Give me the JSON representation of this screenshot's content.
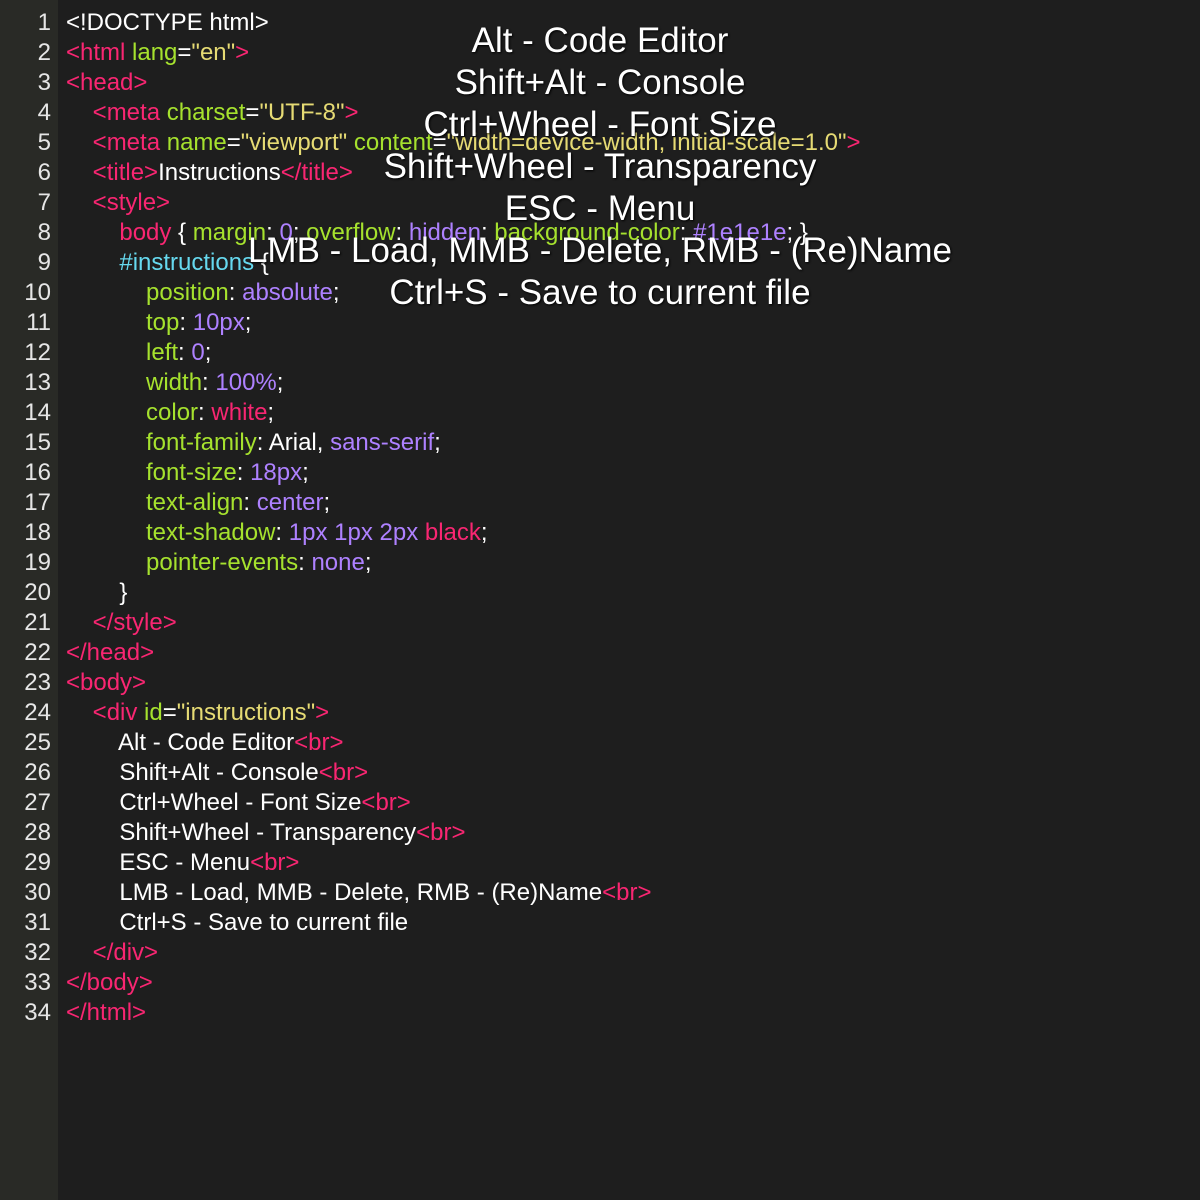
{
  "colors": {
    "background": "#1e1e1e",
    "gutter": "#292a26",
    "tag": "#f92672",
    "attribute": "#a6e22e",
    "string": "#e6db74",
    "number_keyword": "#ae81ff",
    "selector_id": "#66d9ef",
    "plain": "#ffffff"
  },
  "editor": {
    "lines": [
      {
        "n": "1",
        "tokens": [
          {
            "c": "pl",
            "t": "<!DOCTYPE html>"
          }
        ]
      },
      {
        "n": "2",
        "tokens": [
          {
            "c": "tag",
            "t": "<html "
          },
          {
            "c": "attr",
            "t": "lang"
          },
          {
            "c": "pl",
            "t": "="
          },
          {
            "c": "str",
            "t": "\"en\""
          },
          {
            "c": "tag",
            "t": ">"
          }
        ]
      },
      {
        "n": "3",
        "tokens": [
          {
            "c": "tag",
            "t": "<head>"
          }
        ]
      },
      {
        "n": "4",
        "tokens": [
          {
            "c": "pl",
            "t": "    "
          },
          {
            "c": "tag",
            "t": "<meta "
          },
          {
            "c": "attr",
            "t": "charset"
          },
          {
            "c": "pl",
            "t": "="
          },
          {
            "c": "str",
            "t": "\"UTF-8\""
          },
          {
            "c": "tag",
            "t": ">"
          }
        ]
      },
      {
        "n": "5",
        "tokens": [
          {
            "c": "pl",
            "t": "    "
          },
          {
            "c": "tag",
            "t": "<meta "
          },
          {
            "c": "attr",
            "t": "name"
          },
          {
            "c": "pl",
            "t": "="
          },
          {
            "c": "str",
            "t": "\"viewport\""
          },
          {
            "c": "pl",
            "t": " "
          },
          {
            "c": "attr",
            "t": "content"
          },
          {
            "c": "pl",
            "t": "="
          },
          {
            "c": "str",
            "t": "\"width=device-width, initial-scale=1.0\""
          },
          {
            "c": "tag",
            "t": ">"
          }
        ]
      },
      {
        "n": "6",
        "tokens": [
          {
            "c": "pl",
            "t": "    "
          },
          {
            "c": "tag",
            "t": "<title>"
          },
          {
            "c": "pl",
            "t": "Instructions"
          },
          {
            "c": "tag",
            "t": "</title>"
          }
        ]
      },
      {
        "n": "7",
        "tokens": [
          {
            "c": "pl",
            "t": "    "
          },
          {
            "c": "tag",
            "t": "<style>"
          }
        ]
      },
      {
        "n": "8",
        "tokens": [
          {
            "c": "pl",
            "t": "        "
          },
          {
            "c": "tag",
            "t": "body"
          },
          {
            "c": "pl",
            "t": " { "
          },
          {
            "c": "attr",
            "t": "margin"
          },
          {
            "c": "pl",
            "t": ": "
          },
          {
            "c": "num",
            "t": "0"
          },
          {
            "c": "pl",
            "t": "; "
          },
          {
            "c": "attr",
            "t": "overflow"
          },
          {
            "c": "pl",
            "t": ": "
          },
          {
            "c": "num",
            "t": "hidden"
          },
          {
            "c": "pl",
            "t": "; "
          },
          {
            "c": "attr",
            "t": "background-color"
          },
          {
            "c": "pl",
            "t": ": "
          },
          {
            "c": "num",
            "t": "#1e1e1e"
          },
          {
            "c": "pl",
            "t": "; }"
          }
        ]
      },
      {
        "n": "9",
        "tokens": [
          {
            "c": "pl",
            "t": "        "
          },
          {
            "c": "id",
            "t": "#instructions"
          },
          {
            "c": "pl",
            "t": " {"
          }
        ]
      },
      {
        "n": "10",
        "tokens": [
          {
            "c": "pl",
            "t": "            "
          },
          {
            "c": "attr",
            "t": "position"
          },
          {
            "c": "pl",
            "t": ": "
          },
          {
            "c": "num",
            "t": "absolute"
          },
          {
            "c": "pl",
            "t": ";"
          }
        ]
      },
      {
        "n": "11",
        "tokens": [
          {
            "c": "pl",
            "t": "            "
          },
          {
            "c": "attr",
            "t": "top"
          },
          {
            "c": "pl",
            "t": ": "
          },
          {
            "c": "num",
            "t": "10px"
          },
          {
            "c": "pl",
            "t": ";"
          }
        ]
      },
      {
        "n": "12",
        "tokens": [
          {
            "c": "pl",
            "t": "            "
          },
          {
            "c": "attr",
            "t": "left"
          },
          {
            "c": "pl",
            "t": ": "
          },
          {
            "c": "num",
            "t": "0"
          },
          {
            "c": "pl",
            "t": ";"
          }
        ]
      },
      {
        "n": "13",
        "tokens": [
          {
            "c": "pl",
            "t": "            "
          },
          {
            "c": "attr",
            "t": "width"
          },
          {
            "c": "pl",
            "t": ": "
          },
          {
            "c": "num",
            "t": "100%"
          },
          {
            "c": "pl",
            "t": ";"
          }
        ]
      },
      {
        "n": "14",
        "tokens": [
          {
            "c": "pl",
            "t": "            "
          },
          {
            "c": "attr",
            "t": "color"
          },
          {
            "c": "pl",
            "t": ": "
          },
          {
            "c": "tag",
            "t": "white"
          },
          {
            "c": "pl",
            "t": ";"
          }
        ]
      },
      {
        "n": "15",
        "tokens": [
          {
            "c": "pl",
            "t": "            "
          },
          {
            "c": "attr",
            "t": "font-family"
          },
          {
            "c": "pl",
            "t": ": Arial, "
          },
          {
            "c": "num",
            "t": "sans-serif"
          },
          {
            "c": "pl",
            "t": ";"
          }
        ]
      },
      {
        "n": "16",
        "tokens": [
          {
            "c": "pl",
            "t": "            "
          },
          {
            "c": "attr",
            "t": "font-size"
          },
          {
            "c": "pl",
            "t": ": "
          },
          {
            "c": "num",
            "t": "18px"
          },
          {
            "c": "pl",
            "t": ";"
          }
        ]
      },
      {
        "n": "17",
        "tokens": [
          {
            "c": "pl",
            "t": "            "
          },
          {
            "c": "attr",
            "t": "text-align"
          },
          {
            "c": "pl",
            "t": ": "
          },
          {
            "c": "num",
            "t": "center"
          },
          {
            "c": "pl",
            "t": ";"
          }
        ]
      },
      {
        "n": "18",
        "tokens": [
          {
            "c": "pl",
            "t": "            "
          },
          {
            "c": "attr",
            "t": "text-shadow"
          },
          {
            "c": "pl",
            "t": ": "
          },
          {
            "c": "num",
            "t": "1px 1px 2px "
          },
          {
            "c": "tag",
            "t": "black"
          },
          {
            "c": "pl",
            "t": ";"
          }
        ]
      },
      {
        "n": "19",
        "tokens": [
          {
            "c": "pl",
            "t": "            "
          },
          {
            "c": "attr",
            "t": "pointer-events"
          },
          {
            "c": "pl",
            "t": ": "
          },
          {
            "c": "num",
            "t": "none"
          },
          {
            "c": "pl",
            "t": ";"
          }
        ]
      },
      {
        "n": "20",
        "tokens": [
          {
            "c": "pl",
            "t": "        }"
          }
        ]
      },
      {
        "n": "21",
        "tokens": [
          {
            "c": "pl",
            "t": "    "
          },
          {
            "c": "tag",
            "t": "</style>"
          }
        ]
      },
      {
        "n": "22",
        "tokens": [
          {
            "c": "tag",
            "t": "</head>"
          }
        ]
      },
      {
        "n": "23",
        "tokens": [
          {
            "c": "tag",
            "t": "<body>"
          }
        ]
      },
      {
        "n": "24",
        "tokens": [
          {
            "c": "pl",
            "t": "    "
          },
          {
            "c": "tag",
            "t": "<div "
          },
          {
            "c": "attr",
            "t": "id"
          },
          {
            "c": "pl",
            "t": "="
          },
          {
            "c": "str",
            "t": "\"instructions\""
          },
          {
            "c": "tag",
            "t": ">"
          }
        ]
      },
      {
        "n": "25",
        "tokens": [
          {
            "c": "pl",
            "t": "        Alt - Code Editor"
          },
          {
            "c": "tag",
            "t": "<br>"
          }
        ]
      },
      {
        "n": "26",
        "tokens": [
          {
            "c": "pl",
            "t": "        Shift+Alt - Console"
          },
          {
            "c": "tag",
            "t": "<br>"
          }
        ]
      },
      {
        "n": "27",
        "tokens": [
          {
            "c": "pl",
            "t": "        Ctrl+Wheel - Font Size"
          },
          {
            "c": "tag",
            "t": "<br>"
          }
        ]
      },
      {
        "n": "28",
        "tokens": [
          {
            "c": "pl",
            "t": "        Shift+Wheel - Transparency"
          },
          {
            "c": "tag",
            "t": "<br>"
          }
        ]
      },
      {
        "n": "29",
        "tokens": [
          {
            "c": "pl",
            "t": "        ESC - Menu"
          },
          {
            "c": "tag",
            "t": "<br>"
          }
        ]
      },
      {
        "n": "30",
        "tokens": [
          {
            "c": "pl",
            "t": "        LMB - Load, MMB - Delete, RMB - (Re)Name"
          },
          {
            "c": "tag",
            "t": "<br>"
          }
        ]
      },
      {
        "n": "31",
        "tokens": [
          {
            "c": "pl",
            "t": "        Ctrl+S - Save to current file"
          }
        ]
      },
      {
        "n": "32",
        "tokens": [
          {
            "c": "pl",
            "t": "    "
          },
          {
            "c": "tag",
            "t": "</div>"
          }
        ]
      },
      {
        "n": "33",
        "tokens": [
          {
            "c": "tag",
            "t": "</body>"
          }
        ]
      },
      {
        "n": "34",
        "tokens": [
          {
            "c": "tag",
            "t": "</html>"
          }
        ]
      }
    ]
  },
  "overlay": {
    "lines": [
      "Alt - Code Editor",
      "Shift+Alt - Console",
      "Ctrl+Wheel - Font Size",
      "Shift+Wheel - Transparency",
      "ESC - Menu",
      "LMB - Load, MMB - Delete, RMB - (Re)Name",
      "Ctrl+S - Save to current file"
    ]
  }
}
